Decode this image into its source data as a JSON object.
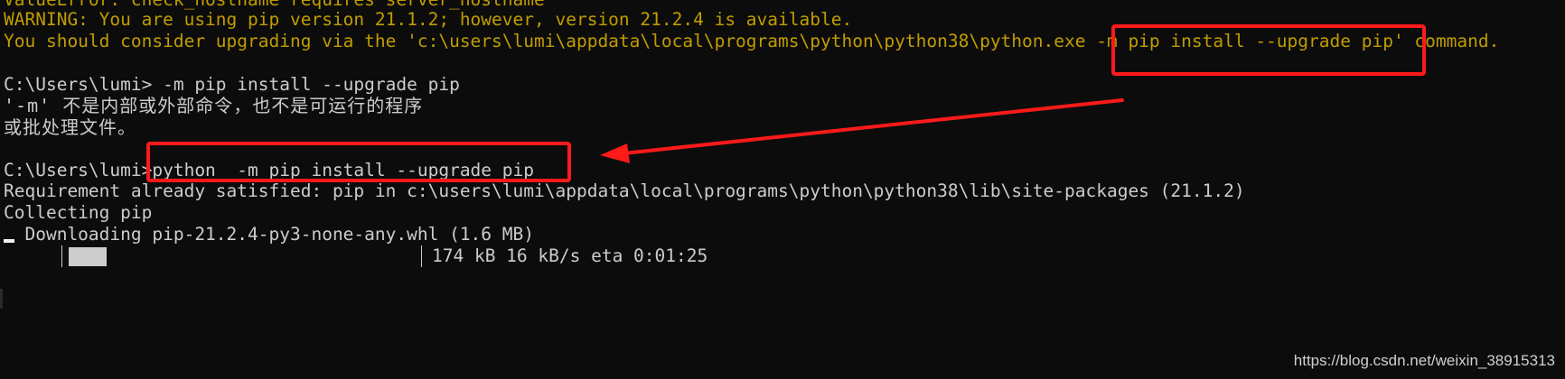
{
  "terminal": {
    "lines": [
      "ValueError: check_hostname requires server_hostname",
      "WARNING: You are using pip version 21.1.2; however, version 21.2.4 is available.",
      "You should consider upgrading via the 'c:\\users\\lumi\\appdata\\local\\programs\\python\\python38\\python.exe -m pip install --upgrade pip' command.",
      "C:\\Users\\lumi> -m pip install --upgrade pip",
      "'-m' 不是内部或外部命令，也不是可运行的程序",
      "或批处理文件。",
      "C:\\Users\\lumi>python  -m pip install --upgrade pip",
      "Requirement already satisfied: pip in c:\\users\\lumi\\appdata\\local\\programs\\python\\python38\\lib\\site-packages (21.1.2)",
      "Collecting pip",
      "  Downloading pip-21.2.4-py3-none-any.whl (1.6 MB)",
      "174 kB 16 kB/s eta 0:01:25"
    ],
    "download_progress": 0.11
  },
  "colors": {
    "background": "#0c0c0c",
    "text": "#cccccc",
    "warning": "#c19c00",
    "annotation": "#ff1a1a"
  },
  "watermark": "https://blog.csdn.net/weixin_38915313"
}
